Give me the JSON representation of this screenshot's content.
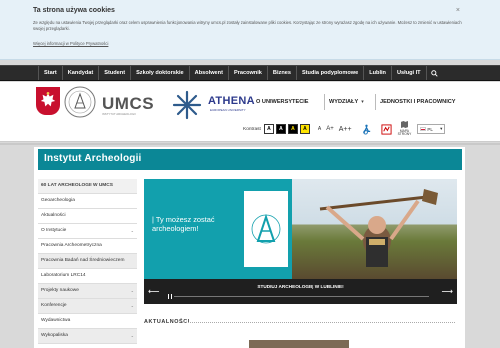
{
  "cookie": {
    "title": "Ta strona używa cookies",
    "text": "Ze względu na ustawienia Twojej przeglądarki oraz celem usprawnienia funkcjonowania witryny umcs.pl zostały zainstalowane pliki cookies. Korzystając ze strony wyrażasz zgodę na ich używanie. Możesz to zmienić w ustawieniach swojej przeglądarki.",
    "link": "Więcej informacji w Polityce Prywatności",
    "close": "×"
  },
  "topnav": {
    "items": [
      "Start",
      "Kandydat",
      "Student",
      "Szkoły doktorskie",
      "Absolwent",
      "Pracownik",
      "Biznes",
      "Studia podyplomowe",
      "Lublin",
      "Usługi IT"
    ]
  },
  "header": {
    "logo_text": "UMCS",
    "logo_sub": "INSTYTUT ARCHEOLOGII",
    "athena": "ATHENA",
    "athena_sub": "EUROPEAN UNIVERSITY",
    "menu_university": "O UNIWERSYTECIE",
    "menu_departments": "WYDZIAŁY",
    "menu_units": "JEDNOSTKI I PRACOWNICY"
  },
  "toolbar": {
    "contrast_label": "Kontrast",
    "contrast_options": [
      "A",
      "A",
      "A",
      "A"
    ],
    "font_sizes": [
      "A",
      "A+",
      "A++"
    ],
    "map_label_1": "MAPA",
    "map_label_2": "STRONY",
    "language": "PL"
  },
  "page": {
    "title": "Instytut Archeologii"
  },
  "sidebar": {
    "items": [
      {
        "label": "60 LAT ARCHEOLOGII W UMCS",
        "arrow": ""
      },
      {
        "label": "Geoarcheologia",
        "arrow": ""
      },
      {
        "label": "Aktualności",
        "arrow": ""
      },
      {
        "label": "O Instytucie",
        "arrow": "⌄"
      },
      {
        "label": "Pracownia Archeometryczna",
        "arrow": ""
      },
      {
        "label": "Pracownia Badań nad Średniowieczem",
        "arrow": ""
      },
      {
        "label": "Laboratorium LRC14",
        "arrow": ""
      },
      {
        "label": "Projekty naukowe",
        "arrow": "⌄"
      },
      {
        "label": "Konferencje",
        "arrow": "⌄"
      },
      {
        "label": "Wydawnictwa",
        "arrow": ""
      },
      {
        "label": "Wykopaliska",
        "arrow": "⌄"
      }
    ]
  },
  "banner": {
    "line1": "| Ty możesz zostać",
    "line2": "archeologiem!",
    "caption": "STUDIUJ ARCHEOLOGIĘ W LUBLINIE!",
    "prev": "⟵",
    "next": "⟶"
  },
  "news": {
    "heading": "AKTUALNOŚCI"
  },
  "colors": {
    "accent": "#0b8796",
    "nav_bg": "#2b2b2b",
    "banner_teal": "#12a0ad"
  }
}
